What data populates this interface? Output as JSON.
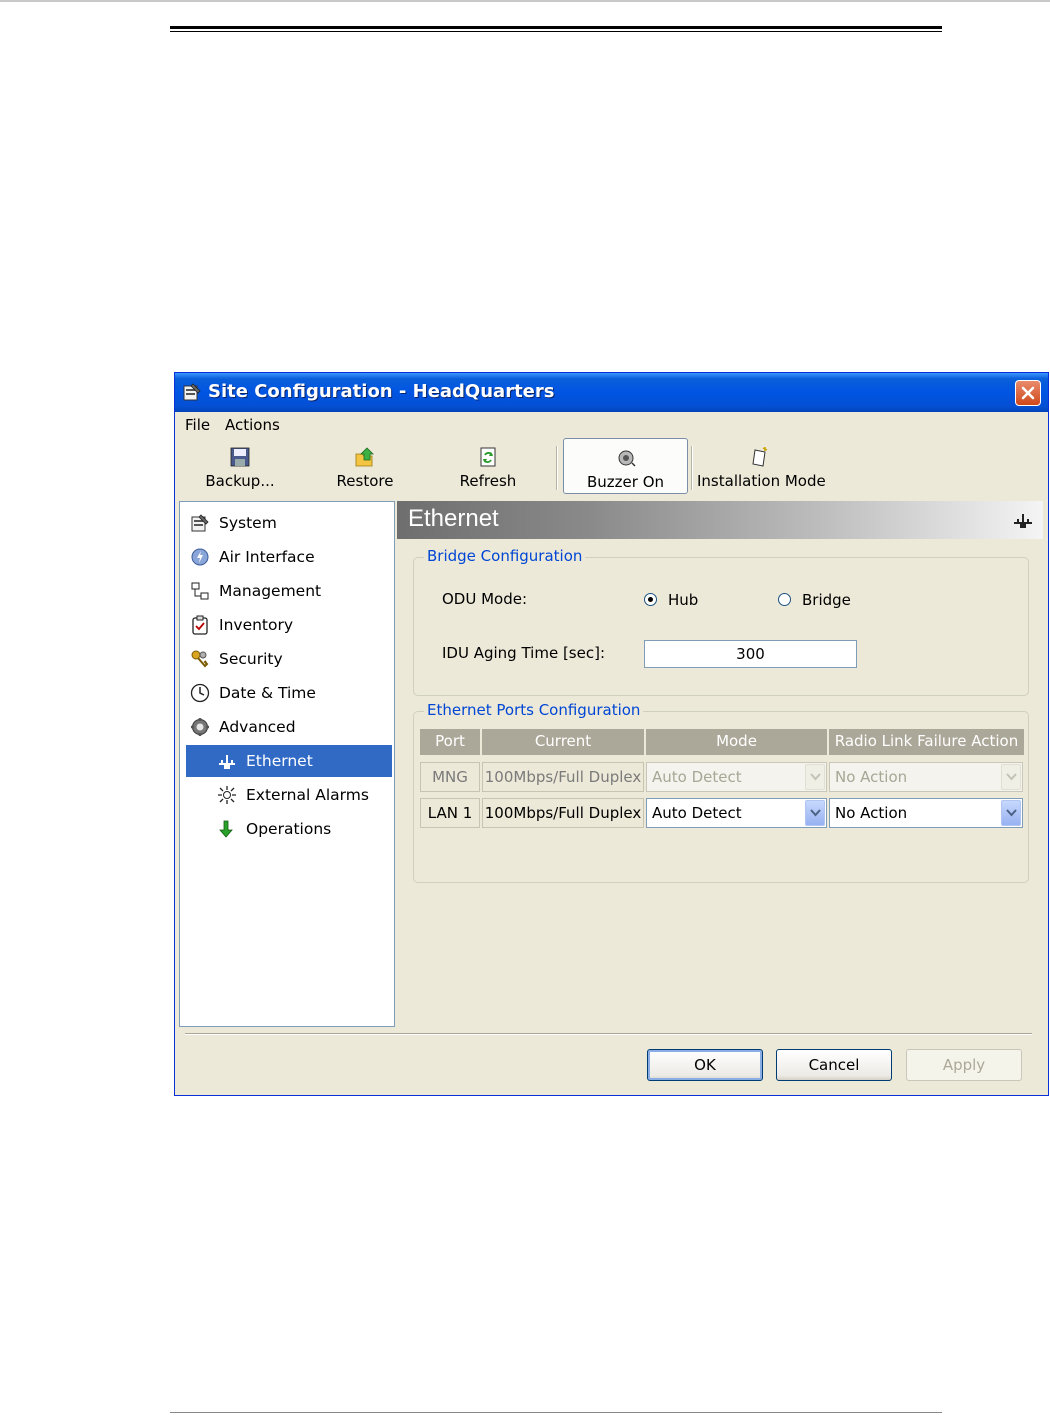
{
  "window": {
    "title": "Site Configuration - HeadQuarters"
  },
  "menu": {
    "file": "File",
    "actions": "Actions"
  },
  "toolbar": {
    "backup": "Backup...",
    "restore": "Restore",
    "refresh": "Refresh",
    "buzzer": "Buzzer On",
    "installation": "Installation Mode"
  },
  "nav": {
    "system": "System",
    "air_interface": "Air Interface",
    "management": "Management",
    "inventory": "Inventory",
    "security": "Security",
    "date_time": "Date & Time",
    "advanced": "Advanced",
    "ethernet": "Ethernet",
    "external_alarms": "External Alarms",
    "operations": "Operations"
  },
  "panel": {
    "title": "Ethernet",
    "bridge_group": "Bridge Configuration",
    "odu_mode_label": "ODU Mode:",
    "odu_mode_options": [
      "Hub",
      "Bridge"
    ],
    "odu_mode_selected": "Hub",
    "aging_label": "IDU Aging Time [sec]:",
    "aging_value": "300",
    "ports_group": "Ethernet Ports Configuration",
    "columns": [
      "Port",
      "Current",
      "Mode",
      "Radio Link Failure Action"
    ],
    "rows": [
      {
        "port": "MNG",
        "current": "100Mbps/Full Duplex",
        "mode": "Auto Detect",
        "action": "No Action",
        "enabled": false
      },
      {
        "port": "LAN 1",
        "current": "100Mbps/Full Duplex",
        "mode": "Auto Detect",
        "action": "No Action",
        "enabled": true
      }
    ]
  },
  "buttons": {
    "ok": "OK",
    "cancel": "Cancel",
    "apply": "Apply"
  }
}
